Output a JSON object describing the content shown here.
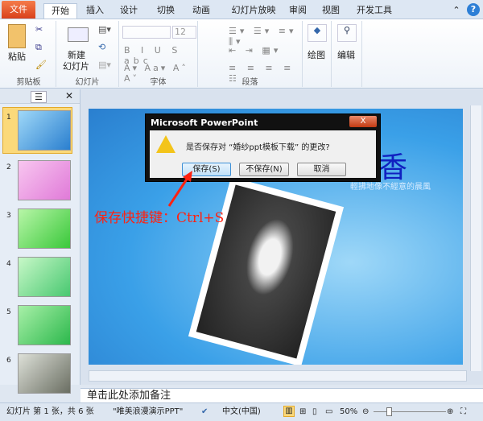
{
  "tabs": [
    "文件",
    "开始",
    "插入",
    "设计",
    "切换",
    "动画",
    "幻灯片放映",
    "审阅",
    "视图",
    "开发工具"
  ],
  "ribbon": {
    "clipboard": {
      "label": "剪贴板",
      "paste": "粘贴"
    },
    "slides": {
      "label": "幻灯片",
      "new_slide_1": "新建",
      "new_slide_2": "幻灯片"
    },
    "font": {
      "label": "字体",
      "size": "12"
    },
    "paragraph": {
      "label": "段落"
    },
    "drawing": "绘图",
    "editing": "编辑"
  },
  "slides_panel": {
    "numbers": [
      "1",
      "2",
      "3",
      "4",
      "5",
      "6"
    ],
    "selected": 1
  },
  "slide": {
    "title_char": "香",
    "subtitle": "輕拂地像不經意的晨風"
  },
  "dialog": {
    "title": "Microsoft PowerPoint",
    "message": "是否保存对 “婚纱ppt模板下载” 的更改?",
    "save": "保存(S)",
    "dont_save": "不保存(N)",
    "cancel": "取消",
    "close": "X"
  },
  "annotation": "保存快捷键：Ctrl+S",
  "notes_placeholder": "单击此处添加备注",
  "status": {
    "slide_info": "幻灯片 第 1 张，共 6 张",
    "theme": "\"唯美浪漫演示PPT\"",
    "language": "中文(中国)",
    "zoom": "50%",
    "zoom_percent": 50
  },
  "colors": {
    "file_tab": "#d9401b",
    "annotation": "#ff2211",
    "slide_bg": "#3aa0e8"
  }
}
